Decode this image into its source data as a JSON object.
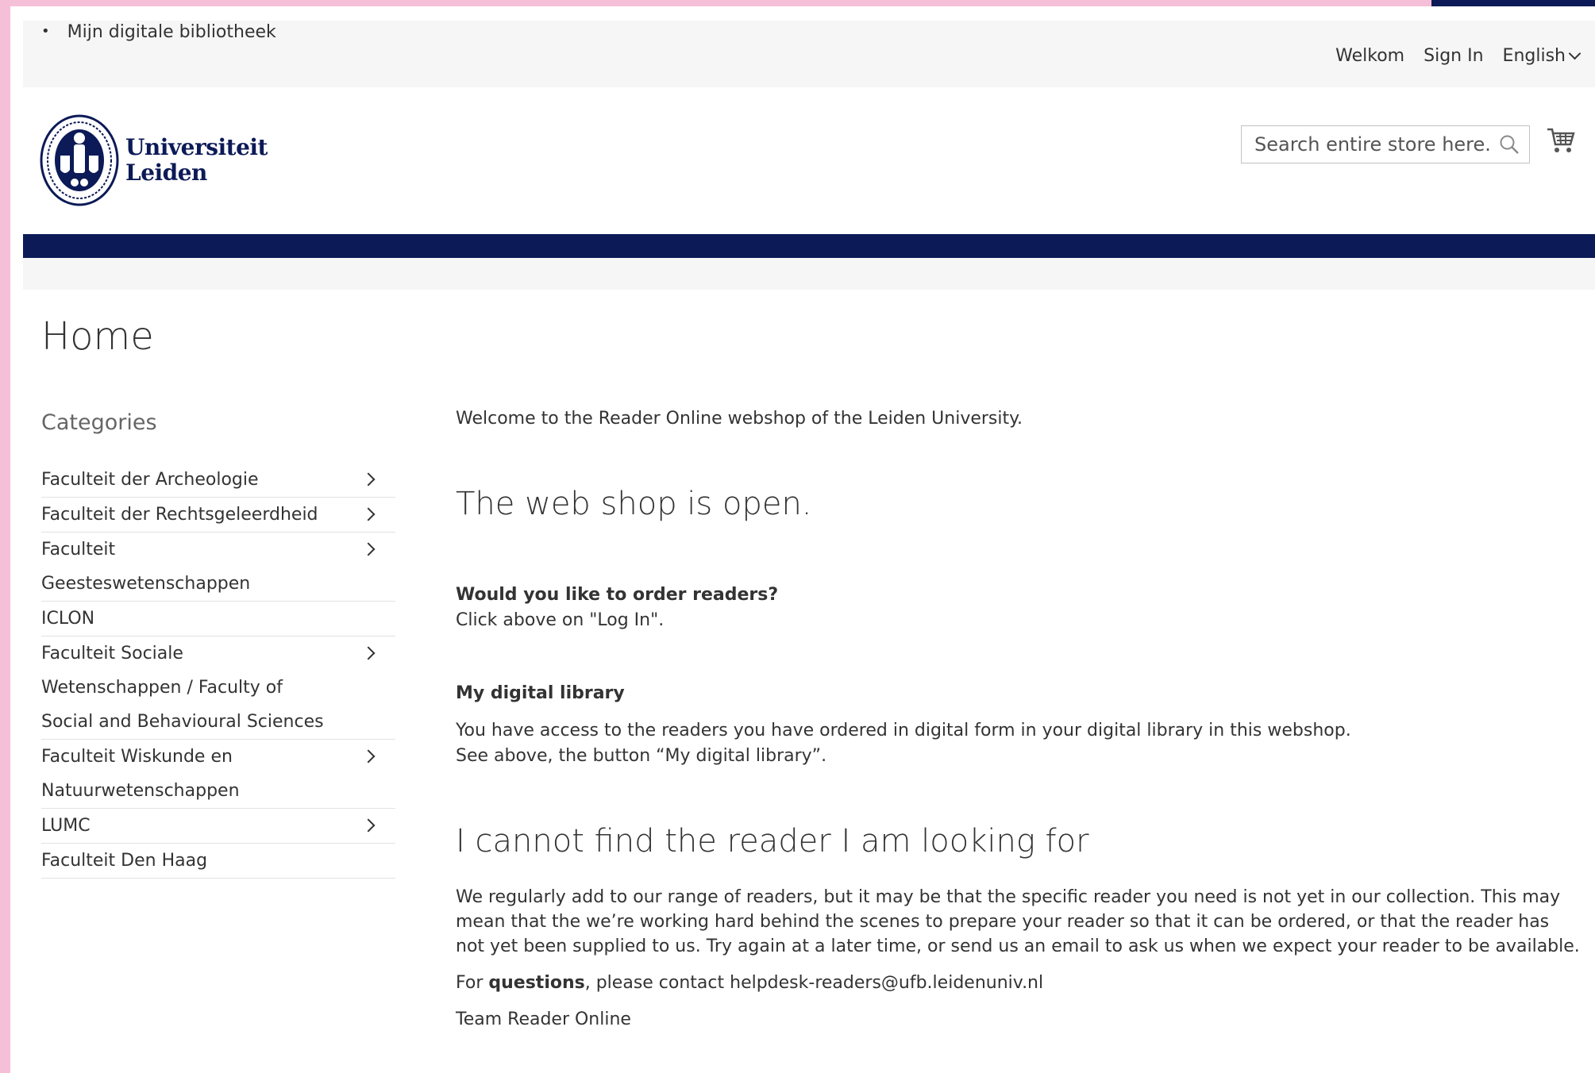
{
  "panel": {
    "list_item": "Mijn digitale bibliotheek",
    "welcome": "Welkom",
    "sign_in": "Sign In",
    "language": "English"
  },
  "logo": {
    "line1": "Universiteit",
    "line2": "Leiden"
  },
  "search": {
    "placeholder": "Search entire store here..."
  },
  "page": {
    "title": "Home"
  },
  "sidebar": {
    "title": "Categories",
    "items": [
      {
        "label": "Faculteit der Archeologie",
        "has_children": true
      },
      {
        "label": "Faculteit der Rechtsgeleerdheid",
        "has_children": true
      },
      {
        "label": "Faculteit Geesteswetenschappen",
        "has_children": true
      },
      {
        "label": "ICLON",
        "has_children": false
      },
      {
        "label": "Faculteit Sociale Wetenschappen / Faculty of Social and Behavioural Sciences",
        "has_children": true
      },
      {
        "label": "Faculteit Wiskunde en Natuurwetenschappen",
        "has_children": true
      },
      {
        "label": "LUMC",
        "has_children": true
      },
      {
        "label": "Faculteit Den Haag",
        "has_children": false
      }
    ]
  },
  "main": {
    "welcome": "Welcome to the Reader Online webshop of the Leiden University.",
    "open_heading": "The web shop is open.",
    "order_question": "Would you like to order readers?",
    "order_text": "Click above on \"Log In\".",
    "library_heading": "My digital library",
    "library_text1": "You have access to the readers you have ordered in digital form in your digital library in this webshop.",
    "library_text2": "See above, the button “My digital library”.",
    "cannot_heading": "I cannot find the reader I am looking for",
    "cannot_text": "We regularly add to our range of readers, but it may be that the specific reader you need is not yet in our collection. This may mean that the we’re working hard behind the scenes to prepare your reader so that it can be ordered, or that the reader has not yet been supplied to us. Try again at a later time, or send us an email to ask us when we expect your reader to be available.",
    "contact_prefix": "For ",
    "contact_bold": "questions",
    "contact_suffix": ", please contact helpdesk-readers@ufb.leidenuniv.nl",
    "team": "Team Reader Online"
  },
  "colors": {
    "brand_navy": "#0c1a57",
    "accent_pink": "#f6bfd8",
    "panel_gray": "#f6f6f6"
  }
}
